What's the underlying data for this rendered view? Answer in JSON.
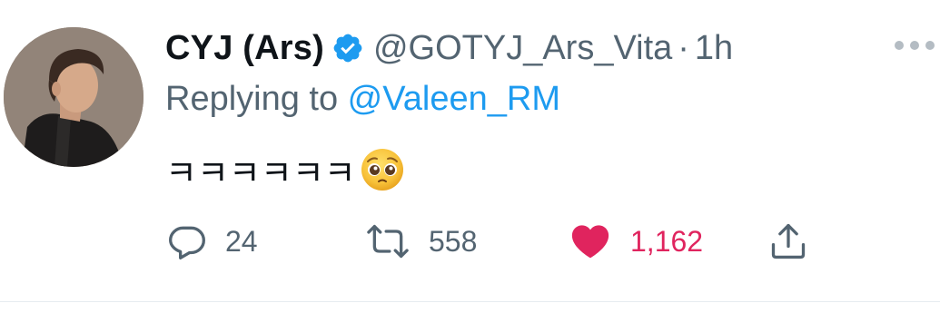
{
  "tweet": {
    "display_name": "CYJ (Ars)",
    "handle": "@GOTYJ_Ars_Vita",
    "separator": "·",
    "time": "1h",
    "replying_prefix": "Replying to ",
    "replying_to": "@Valeen_RM",
    "text": "ㅋㅋㅋㅋㅋㅋ",
    "emoji": "pleading-face-emoji"
  },
  "actions": {
    "reply_count": "24",
    "retweet_count": "558",
    "like_count": "1,162",
    "liked": true
  },
  "colors": {
    "accent": "#1d9bf0",
    "like": "#e0245e",
    "secondary_text": "#536471",
    "primary_text": "#0f1419"
  },
  "icons": [
    "verified-badge-icon",
    "more-icon",
    "reply-icon",
    "retweet-icon",
    "heart-icon",
    "share-icon"
  ]
}
